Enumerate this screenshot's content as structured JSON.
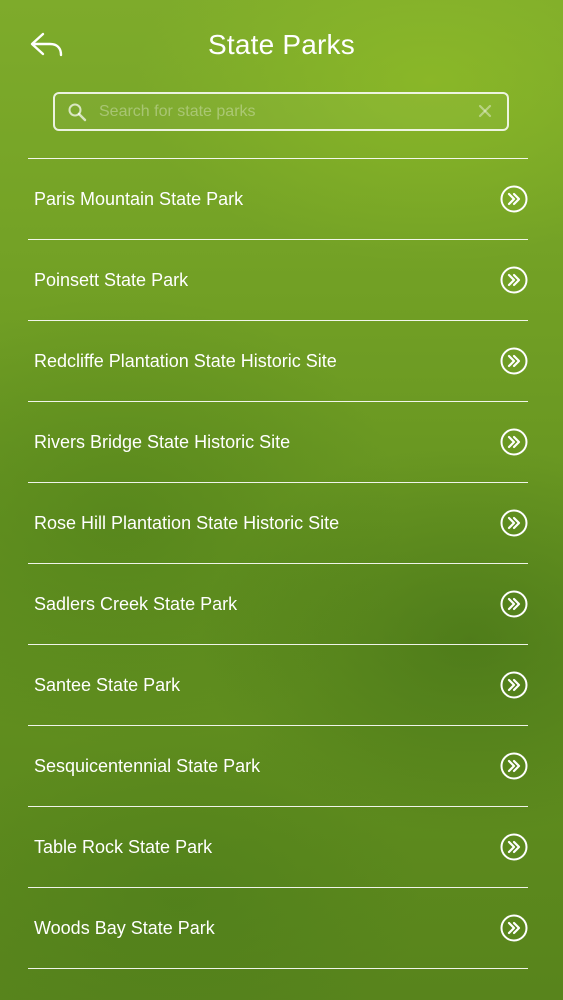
{
  "header": {
    "title": "State Parks",
    "back_icon": "back-arrow-icon"
  },
  "search": {
    "placeholder": "Search for state parks",
    "value": "",
    "icon": "search-icon",
    "clear_icon": "clear-icon"
  },
  "parks": [
    {
      "name": "Paris Mountain State Park"
    },
    {
      "name": "Poinsett State Park"
    },
    {
      "name": "Redcliffe Plantation State Historic Site"
    },
    {
      "name": "Rivers Bridge State Historic Site"
    },
    {
      "name": "Rose Hill Plantation State Historic Site"
    },
    {
      "name": "Sadlers Creek State Park"
    },
    {
      "name": "Santee State Park"
    },
    {
      "name": "Sesquicentennial State Park"
    },
    {
      "name": "Table Rock State Park"
    },
    {
      "name": "Woods Bay State Park"
    }
  ],
  "colors": {
    "background": "#6a9822",
    "text": "#ffffff"
  }
}
